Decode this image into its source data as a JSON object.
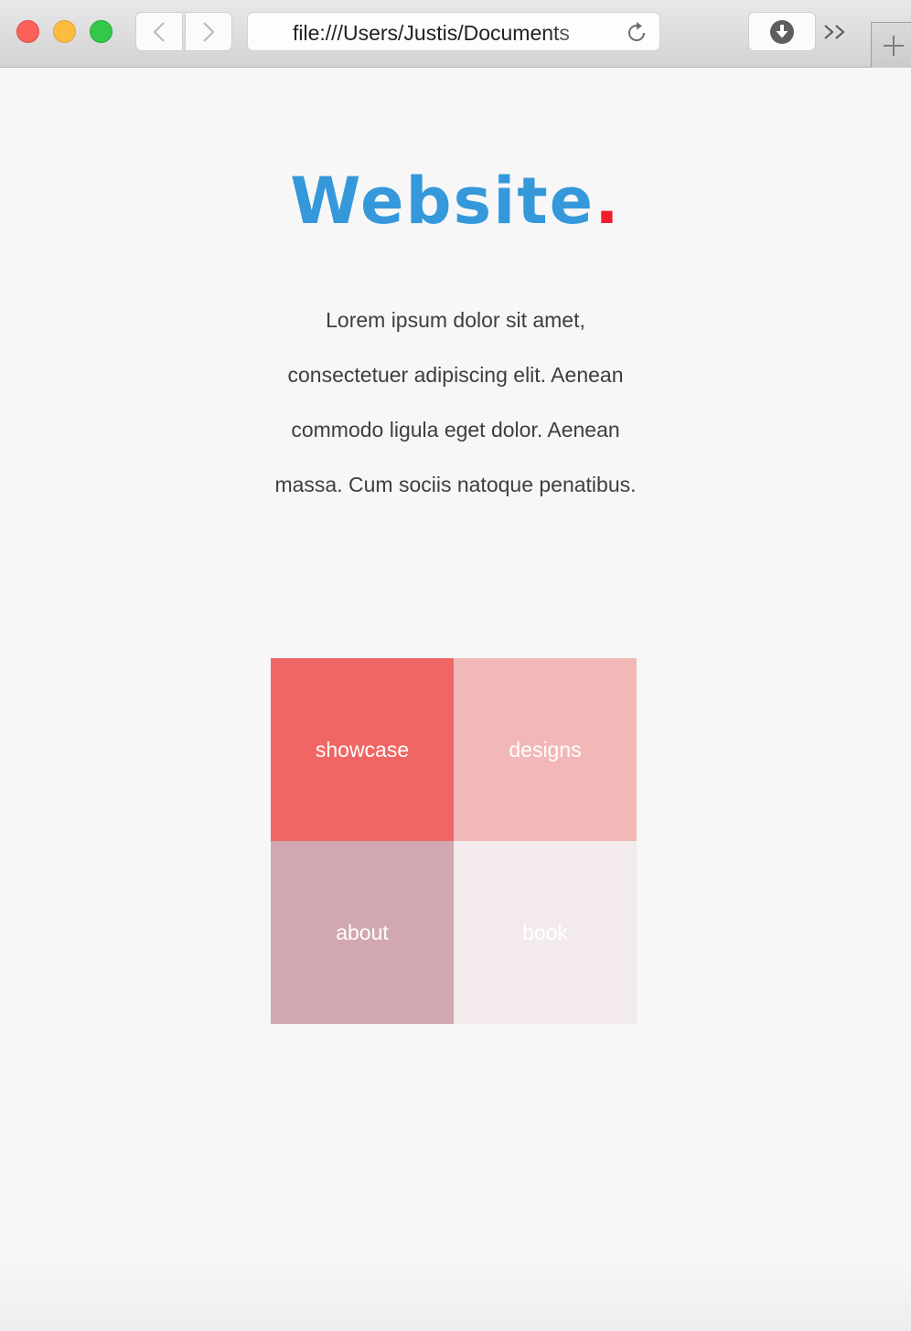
{
  "browser": {
    "address": "file:///Users/Justis/Documents",
    "back_icon": "chevron-left-icon",
    "forward_icon": "chevron-right-icon",
    "reload_icon": "reload-icon",
    "download_icon": "download-icon",
    "overflow_label": ">>",
    "new_tab_icon": "plus-icon"
  },
  "page": {
    "logo_text": "Website",
    "logo_dot": ".",
    "logo_color": "#3498db",
    "logo_dot_color": "#f21b2d",
    "intro": "Lorem ipsum dolor sit amet, consectetuer adipiscing elit. Aenean commodo ligula eget dolor. Aenean massa. Cum sociis natoque penatibus.",
    "tiles": [
      {
        "label": "showcase",
        "color": "#f06664"
      },
      {
        "label": "designs",
        "color": "#f1b8b7"
      },
      {
        "label": "about",
        "color": "#d1a8b0"
      },
      {
        "label": "book",
        "color": "#f3eaeb"
      }
    ]
  }
}
